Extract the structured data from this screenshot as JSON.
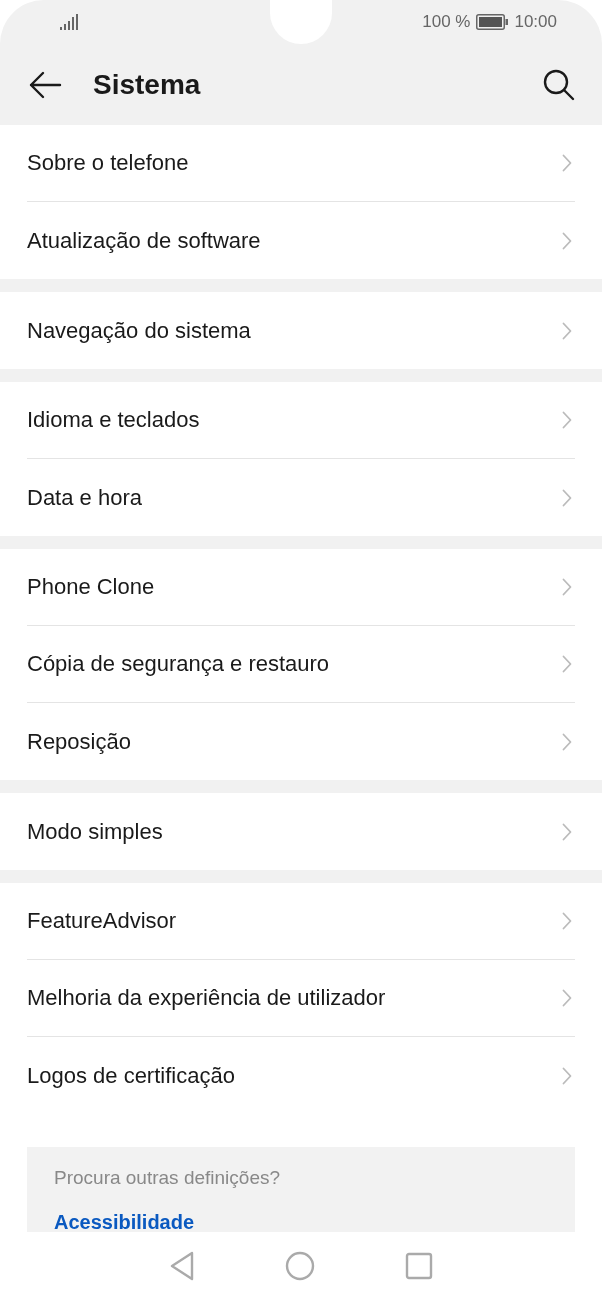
{
  "status_bar": {
    "battery_text": "100 %",
    "time": "10:00"
  },
  "header": {
    "title": "Sistema"
  },
  "groups": [
    {
      "items": [
        {
          "label": "Sobre o telefone"
        },
        {
          "label": "Atualização de software"
        }
      ]
    },
    {
      "items": [
        {
          "label": "Navegação do sistema"
        }
      ]
    },
    {
      "items": [
        {
          "label": "Idioma e teclados"
        },
        {
          "label": "Data e hora"
        }
      ]
    },
    {
      "items": [
        {
          "label": "Phone Clone"
        },
        {
          "label": "Cópia de segurança e restauro"
        },
        {
          "label": "Reposição"
        }
      ]
    },
    {
      "items": [
        {
          "label": "Modo simples"
        }
      ]
    },
    {
      "items": [
        {
          "label": "FeatureAdvisor"
        },
        {
          "label": "Melhoria da experiência de utilizador"
        },
        {
          "label": "Logos de certificação"
        }
      ]
    }
  ],
  "suggestion_card": {
    "hint": "Procura outras definições?",
    "link": "Acessibilidade"
  }
}
